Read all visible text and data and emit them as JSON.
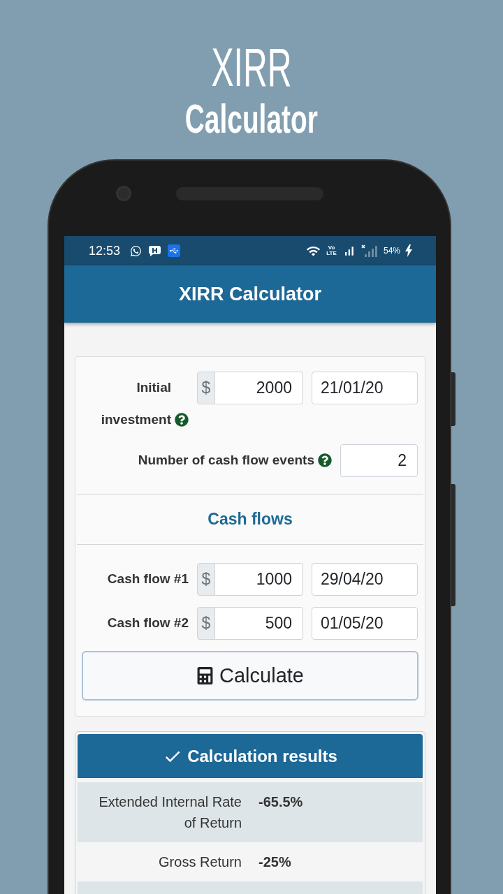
{
  "promo": {
    "title": "XIRR",
    "subtitle": "Calculator"
  },
  "status_bar": {
    "time": "12:53",
    "network_type": "Vo LTE",
    "battery": "54%"
  },
  "app_bar": {
    "title": "XIRR Calculator"
  },
  "form": {
    "initial_investment": {
      "label": "Initial investment",
      "currency": "$",
      "amount": "2000",
      "date": "21/01/20"
    },
    "events": {
      "label": "Number of cash flow events",
      "value": "2"
    },
    "section_title": "Cash flows",
    "cash_flows": [
      {
        "label": "Cash flow #1",
        "currency": "$",
        "amount": "1000",
        "date": "29/04/20"
      },
      {
        "label": "Cash flow #2",
        "currency": "$",
        "amount": "500",
        "date": "01/05/20"
      }
    ],
    "calculate_button": "Calculate"
  },
  "results": {
    "title": "Calculation results",
    "rows": [
      {
        "label": "Extended Internal Rate of Return",
        "value": "-65.5%"
      },
      {
        "label": "Gross Return",
        "value": "-25%"
      }
    ]
  }
}
